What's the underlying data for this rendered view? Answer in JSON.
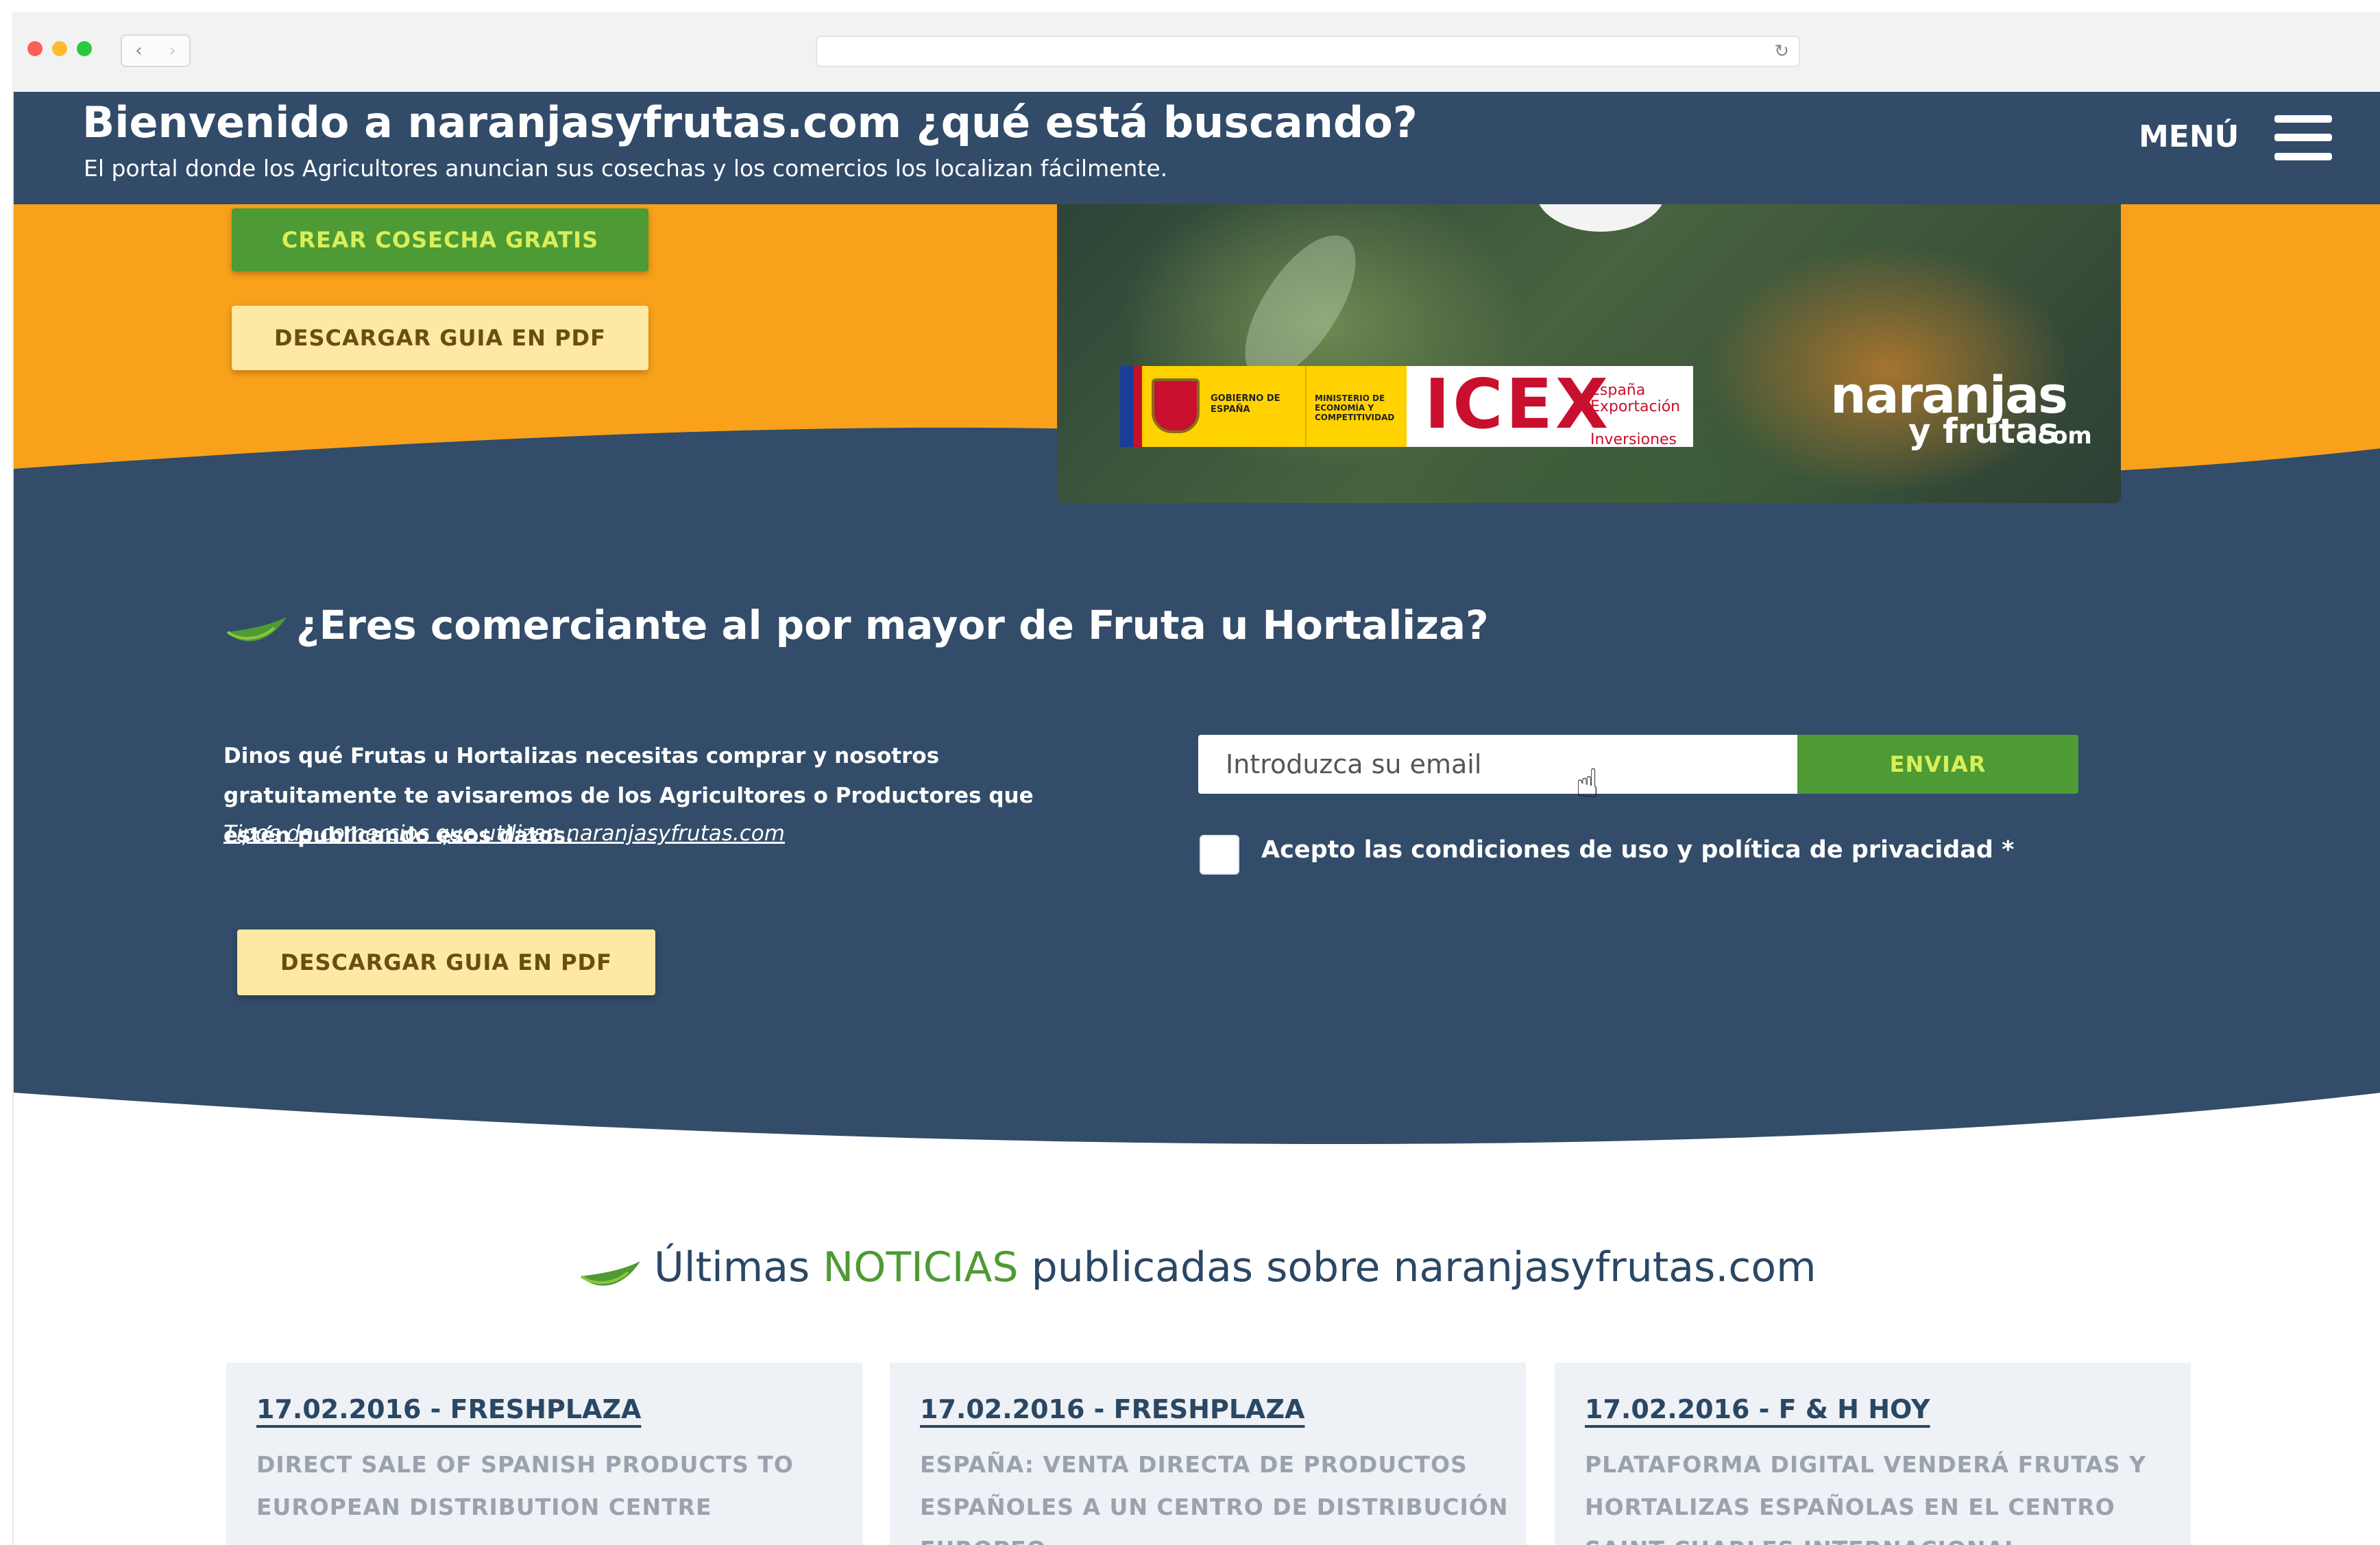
{
  "header": {
    "title": "Bienvenido a naranjasyfrutas.com ¿qué está buscando?",
    "subtitle": "El portal donde los Agricultores anuncian sus cosechas y los comercios los localizan fácilmente.",
    "menu_label": "MENÚ"
  },
  "hero": {
    "create_button": "CREAR COSECHA GRATIS",
    "guide_button": "DESCARGAR GUIA EN PDF",
    "sponsor": {
      "gov_text": "GOBIERNO DE ESPAÑA",
      "ministry_text": "MINISTERIO DE ECONOMÍA Y COMPETITIVIDAD",
      "icex": "ICEX",
      "icex_sub": "España Exportación e Inversiones"
    },
    "brand": {
      "line1": "naranjas",
      "line2": "y frutas",
      "suffix": ".com"
    }
  },
  "wholesale": {
    "title": "¿Eres comerciante al por mayor de Fruta u Hortaliza?",
    "description": "Dinos qué Frutas u Hortalizas necesitas comprar y nosotros gratuitamente te avisaremos de los Agricultores o Productores que estén publicando esos datos.",
    "link": "Tipos de comercios que utilizan naranjasyfrutas.com",
    "guide_button": "DESCARGAR GUIA EN PDF",
    "email_placeholder": "Introduzca su email",
    "send_button": "ENVIAR",
    "terms_label": "Acepto las condiciones de uso y política de privacidad *"
  },
  "news": {
    "title_pre": "Últimas",
    "title_accent": "NOTICIAS",
    "title_post": "publicadas sobre naranjasyfrutas.com",
    "items": [
      {
        "date": "17.02.2016 - FRESHPLAZA",
        "text": "DIRECT SALE OF SPANISH PRODUCTS TO EUROPEAN DISTRIBUTION CENTRE"
      },
      {
        "date": "17.02.2016 - FRESHPLAZA",
        "text": "ESPAÑA: VENTA DIRECTA DE PRODUCTOS ESPAÑOLES A UN CENTRO DE DISTRIBUCIÓN EUROPEO"
      },
      {
        "date": "17.02.2016 - F & H HOY",
        "text": "PLATAFORMA DIGITAL VENDERÁ FRUTAS Y HORTALIZAS ESPAÑOLAS EN EL CENTRO SAINT CHARLES INTERNACIONAL"
      }
    ]
  },
  "colors": {
    "navy": "#314b69",
    "orange": "#f9a11b",
    "green": "#4e9a34",
    "lime_text": "#d8ef5a",
    "cream": "#fde9a3"
  },
  "icons": [
    "back-icon",
    "forward-icon",
    "reload-icon",
    "hamburger-icon",
    "leaf-icon",
    "pointer-cursor-icon"
  ]
}
